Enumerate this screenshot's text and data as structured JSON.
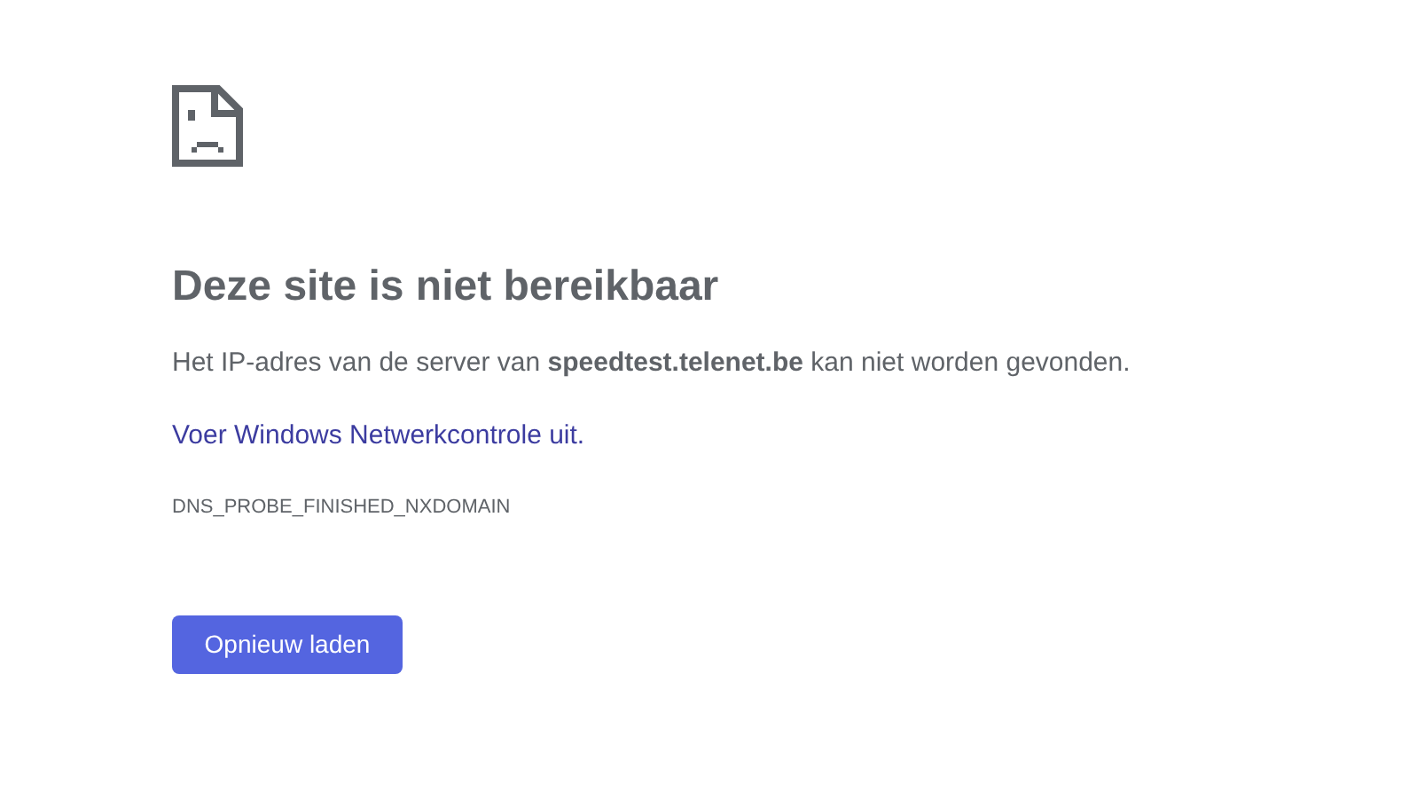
{
  "title": "Deze site is niet bereikbaar",
  "message": "Het IP-adres van de server van **speedtest.telenet.be** kan niet worden gevonden.",
  "link": "Voer Windows Netwerkcontrole uit.",
  "error_code": "DNS_PROBE_FINISHED_NXDOMAIN",
  "button": "Opnieuw laden"
}
